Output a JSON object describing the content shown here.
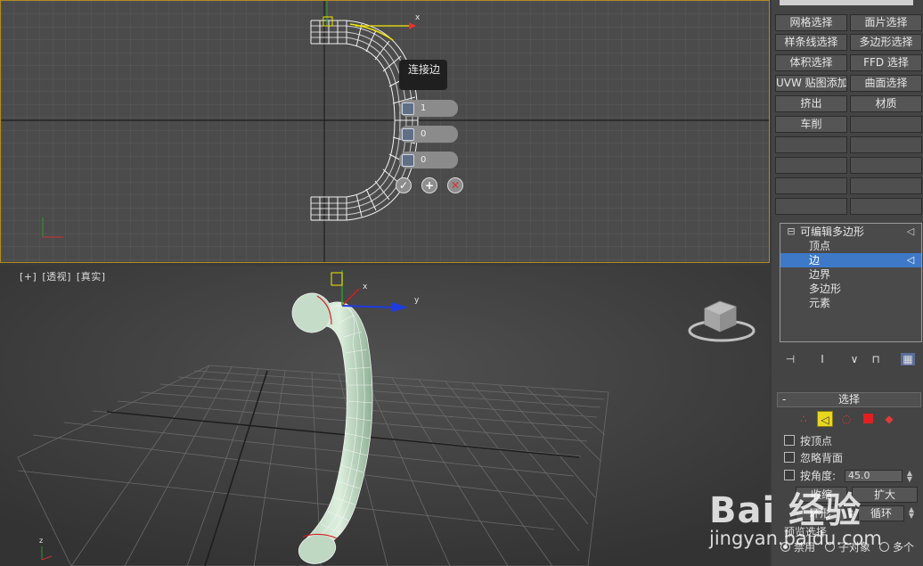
{
  "viewport_top": {
    "caddy_title": "连接边",
    "caddy_fields": [
      "1",
      "0",
      "0"
    ],
    "caddy_buttons": [
      "✓",
      "+",
      "✕"
    ],
    "axis_x": "x"
  },
  "viewport_persp": {
    "label_parts": [
      "[+]",
      "[透视]",
      "[真实]"
    ],
    "axis_x": "x",
    "axis_y": "y",
    "axis_z": "z"
  },
  "command_panel": {
    "modifier_buttons": [
      [
        "网格选择",
        "面片选择"
      ],
      [
        "样条线选择",
        "多边形选择"
      ],
      [
        "体积选择",
        "FFD 选择"
      ],
      [
        "UVW 贴图添加",
        "曲面选择"
      ],
      [
        "挤出",
        "材质"
      ],
      [
        "车削",
        ""
      ]
    ],
    "stack": {
      "root": "可编辑多边形",
      "items": [
        "顶点",
        "边",
        "边界",
        "多边形",
        "元素"
      ],
      "selected_index": 1
    },
    "selection_rollout": {
      "title": "选择",
      "by_vertex": "按顶点",
      "ignore_backfacing": "忽略背面",
      "angle_label": "按角度:",
      "angle_value": "45.0",
      "shrink": "收缩",
      "grow": "扩大",
      "ring": "环形",
      "loop": "循环",
      "preview_label": "预览选择",
      "radio_options": [
        "禁用",
        "子对象",
        "多个"
      ],
      "radio_selected": 0
    }
  },
  "colors": {
    "accent_selected": "#3e79c8",
    "viewport_border_active": "#b08a22",
    "vertex_icon_red": "#e03a3a",
    "edge_icon_yellow": "#e8d620"
  },
  "icons": {
    "stack_collapse": "minus-box-icon",
    "pin": "pin-stack-icon",
    "show_end_result": "show-end-result-icon",
    "make_unique": "make-unique-icon",
    "remove_modifier": "remove-modifier-icon",
    "configure": "configure-modifier-sets-icon"
  },
  "watermark": {
    "brand": "Bai 经验",
    "url": "jingyan.baidu.com"
  }
}
